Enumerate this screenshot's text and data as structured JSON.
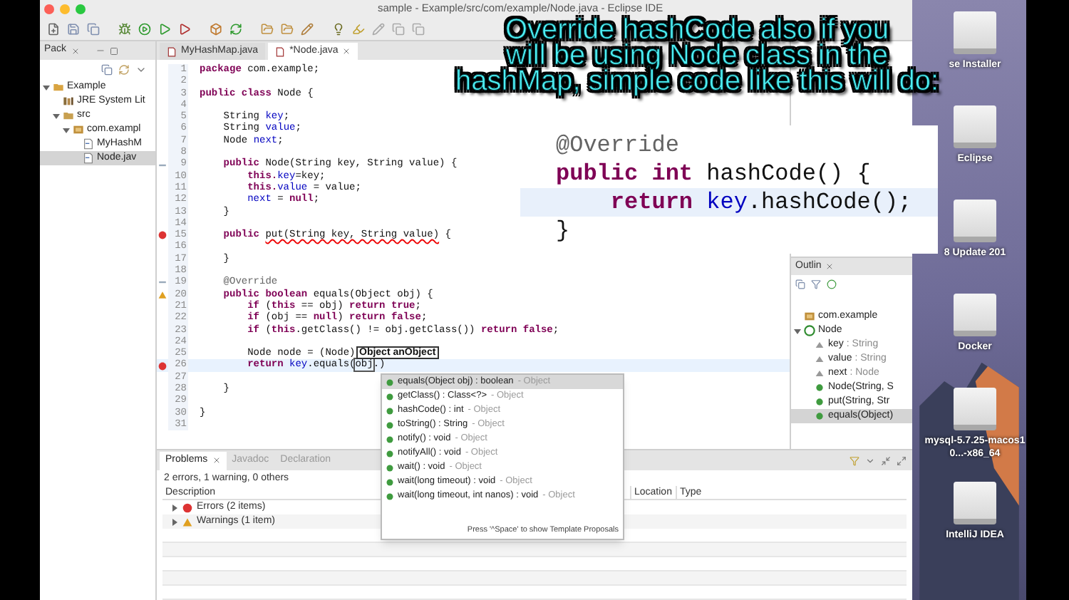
{
  "window": {
    "title": "sample - Example/src/com/example/Node.java - Eclipse IDE"
  },
  "package_explorer": {
    "tab": "Pack",
    "tree": [
      {
        "label": "Example",
        "kind": "project",
        "expanded": true,
        "selected": false,
        "children": [
          {
            "label": "JRE System Lit",
            "kind": "library",
            "selected": false
          },
          {
            "label": "src",
            "kind": "source",
            "expanded": true,
            "selected": false,
            "children": [
              {
                "label": "com.exampl",
                "kind": "package",
                "expanded": true,
                "selected": false,
                "children": [
                  {
                    "label": "MyHashM",
                    "kind": "file",
                    "selected": false
                  },
                  {
                    "label": "Node.jav",
                    "kind": "file",
                    "selected": true
                  }
                ]
              }
            ]
          }
        ]
      }
    ]
  },
  "editor_tabs": [
    {
      "label": "MyHashMap.java",
      "selected": false
    },
    {
      "label": "*Node.java",
      "selected": true
    }
  ],
  "code_lines": [
    {
      "number": "1",
      "kind": "plain",
      "current": false,
      "tokens": [
        {
          "kind": "keyword",
          "text": "package"
        },
        {
          "kind": "plain",
          "text": " com.example;"
        }
      ]
    },
    {
      "number": "2",
      "kind": "plain",
      "current": false
    },
    {
      "number": "3",
      "kind": "plain",
      "current": false,
      "tokens": [
        {
          "kind": "keyword",
          "text": "public class"
        },
        {
          "kind": "plain",
          "text": " Node {"
        }
      ]
    },
    {
      "number": "4",
      "kind": "plain",
      "current": false
    },
    {
      "number": "5",
      "kind": "plain",
      "current": false,
      "tokens": [
        {
          "kind": "plain",
          "text": "    String "
        },
        {
          "kind": "field",
          "text": "key"
        },
        {
          "kind": "plain",
          "text": ";"
        }
      ]
    },
    {
      "number": "6",
      "kind": "plain",
      "current": false,
      "tokens": [
        {
          "kind": "plain",
          "text": "    String "
        },
        {
          "kind": "field",
          "text": "value"
        },
        {
          "kind": "plain",
          "text": ";"
        }
      ]
    },
    {
      "number": "7",
      "kind": "plain",
      "current": false,
      "tokens": [
        {
          "kind": "plain",
          "text": "    Node "
        },
        {
          "kind": "field",
          "text": "next"
        },
        {
          "kind": "plain",
          "text": ";"
        }
      ]
    },
    {
      "number": "8",
      "kind": "plain",
      "current": false
    },
    {
      "number": "9",
      "kind": "fold",
      "current": false,
      "tokens": [
        {
          "kind": "keyword",
          "text": "    public"
        },
        {
          "kind": "plain",
          "text": " Node(String key, String value) {"
        }
      ]
    },
    {
      "number": "10",
      "kind": "plain",
      "current": false,
      "tokens": [
        {
          "kind": "keyword",
          "text": "        this."
        },
        {
          "kind": "field",
          "text": "key"
        },
        {
          "kind": "plain",
          "text": "=key;"
        }
      ]
    },
    {
      "number": "11",
      "kind": "plain",
      "current": false,
      "tokens": [
        {
          "kind": "keyword",
          "text": "        this."
        },
        {
          "kind": "field",
          "text": "value"
        },
        {
          "kind": "plain",
          "text": " = value;"
        }
      ]
    },
    {
      "number": "12",
      "kind": "plain",
      "current": false,
      "tokens": [
        {
          "kind": "field",
          "text": "        next"
        },
        {
          "kind": "plain",
          "text": " = "
        },
        {
          "kind": "keyword",
          "text": "null"
        },
        {
          "kind": "plain",
          "text": ";"
        }
      ]
    },
    {
      "number": "13",
      "kind": "plain",
      "current": false,
      "tokens": [
        {
          "kind": "plain",
          "text": "    }"
        }
      ]
    },
    {
      "number": "14",
      "kind": "plain",
      "current": false
    },
    {
      "number": "15",
      "kind": "error",
      "current": false,
      "tokens": [
        {
          "kind": "keyword",
          "text": "    public "
        },
        {
          "kind": "error",
          "text": "put(String key, String value)"
        },
        {
          "kind": "plain",
          "text": " {"
        }
      ]
    },
    {
      "number": "16",
      "kind": "plain",
      "current": false
    },
    {
      "number": "17",
      "kind": "plain",
      "current": false,
      "tokens": [
        {
          "kind": "plain",
          "text": "    }"
        }
      ]
    },
    {
      "number": "18",
      "kind": "plain",
      "current": false
    },
    {
      "number": "19",
      "kind": "fold",
      "current": false,
      "tokens": [
        {
          "kind": "annotation",
          "text": "    @Override"
        }
      ]
    },
    {
      "number": "20",
      "kind": "warning",
      "current": false,
      "tokens": [
        {
          "kind": "keyword",
          "text": "    public boolean"
        },
        {
          "kind": "plain",
          "text": " equals(Object obj) {"
        }
      ]
    },
    {
      "number": "21",
      "kind": "plain",
      "current": false,
      "tokens": [
        {
          "kind": "keyword",
          "text": "        if"
        },
        {
          "kind": "plain",
          "text": " ("
        },
        {
          "kind": "keyword",
          "text": "this"
        },
        {
          "kind": "plain",
          "text": " == obj) "
        },
        {
          "kind": "keyword",
          "text": "return true"
        },
        {
          "kind": "plain",
          "text": ";"
        }
      ]
    },
    {
      "number": "22",
      "kind": "plain",
      "current": false,
      "tokens": [
        {
          "kind": "keyword",
          "text": "        if"
        },
        {
          "kind": "plain",
          "text": " (obj == "
        },
        {
          "kind": "keyword",
          "text": "null"
        },
        {
          "kind": "plain",
          "text": ") "
        },
        {
          "kind": "keyword",
          "text": "return false"
        },
        {
          "kind": "plain",
          "text": ";"
        }
      ]
    },
    {
      "number": "23",
      "kind": "plain",
      "current": false,
      "tokens": [
        {
          "kind": "keyword",
          "text": "        if"
        },
        {
          "kind": "plain",
          "text": " ("
        },
        {
          "kind": "keyword",
          "text": "this"
        },
        {
          "kind": "plain",
          "text": ".getClass() != obj.getClass()) "
        },
        {
          "kind": "keyword",
          "text": "return false"
        },
        {
          "kind": "plain",
          "text": ";"
        }
      ]
    },
    {
      "number": "24",
      "kind": "plain",
      "current": false
    },
    {
      "number": "25",
      "kind": "plain",
      "current": false,
      "tokens": [
        {
          "kind": "plain",
          "text": "        Node node = (Node)"
        }
      ]
    },
    {
      "number": "26",
      "kind": "error",
      "current": true,
      "tokens": [
        {
          "kind": "keyword",
          "text": "        return "
        },
        {
          "kind": "field",
          "text": "key"
        },
        {
          "kind": "plain",
          "text": ".equals("
        },
        {
          "kind": "boxed",
          "text": "obj"
        },
        {
          "kind": "plain",
          "text": ".)"
        }
      ]
    },
    {
      "number": "27",
      "kind": "plain",
      "current": false
    },
    {
      "number": "28",
      "kind": "plain",
      "current": false,
      "tokens": [
        {
          "kind": "plain",
          "text": "    }"
        }
      ]
    },
    {
      "number": "29",
      "kind": "plain",
      "current": false
    },
    {
      "number": "30",
      "kind": "plain",
      "current": false,
      "tokens": [
        {
          "kind": "plain",
          "text": "}"
        }
      ]
    },
    {
      "number": "31",
      "kind": "plain",
      "current": false
    }
  ],
  "tooltip": {
    "text": "Object anObject"
  },
  "autocomplete": {
    "items": [
      {
        "signature": "equals(Object obj) : boolean",
        "owner": "- Object",
        "selected": true
      },
      {
        "signature": "getClass() : Class<?>",
        "owner": "- Object",
        "selected": false
      },
      {
        "signature": "hashCode() : int",
        "owner": "- Object",
        "selected": false
      },
      {
        "signature": "toString() : String",
        "owner": "- Object",
        "selected": false
      },
      {
        "signature": "notify() : void",
        "owner": "- Object",
        "selected": false
      },
      {
        "signature": "notifyAll() : void",
        "owner": "- Object",
        "selected": false
      },
      {
        "signature": "wait() : void",
        "owner": "- Object",
        "selected": false
      },
      {
        "signature": "wait(long timeout) : void",
        "owner": "- Object",
        "selected": false
      },
      {
        "signature": "wait(long timeout, int nanos) : void",
        "owner": "- Object",
        "selected": false
      }
    ],
    "footer": "Press '^Space' to show Template Proposals"
  },
  "outline": {
    "tab": "Outlin",
    "tree": [
      {
        "label": "com.example",
        "kind": "package",
        "selected": false
      },
      {
        "label": "Node",
        "kind": "class",
        "expanded": true,
        "selected": false,
        "children": [
          {
            "label": "key",
            "type": ": String",
            "kind": "field",
            "selected": false
          },
          {
            "label": "value",
            "type": ": String",
            "kind": "field",
            "selected": false
          },
          {
            "label": "next",
            "type": ": Node",
            "kind": "field",
            "selected": false
          },
          {
            "label": "Node(String, S",
            "kind": "method",
            "selected": false
          },
          {
            "label": "put(String, Str",
            "kind": "method",
            "selected": false
          },
          {
            "label": "equals(Object)",
            "kind": "method",
            "selected": true
          }
        ]
      }
    ]
  },
  "problems": {
    "tabs": [
      {
        "label": "Problems",
        "selected": true
      },
      {
        "label": "Javadoc",
        "selected": false
      },
      {
        "label": "Declaration",
        "selected": false
      }
    ],
    "summary": "2 errors, 1 warning, 0 others",
    "columns": [
      {
        "label": "Description"
      },
      {
        "label": "Location"
      },
      {
        "label": "Type"
      }
    ],
    "rows": [
      {
        "label": "Errors (2 items)",
        "kind": "error",
        "expanded": false
      },
      {
        "label": "Warnings (1 item)",
        "kind": "warning",
        "expanded": false
      }
    ]
  },
  "desktop": {
    "icons": [
      {
        "label": "se Installer"
      },
      {
        "label": "Eclipse"
      },
      {
        "label": "8 Update 201"
      },
      {
        "label": "Docker"
      },
      {
        "label": "mysql-5.7.25-macos10...-x86_64"
      },
      {
        "label": "IntelliJ IDEA"
      }
    ]
  },
  "caption": {
    "lines": [
      "Override hashCode also if you",
      "will be using Node class in the",
      "hashMap, simple code like this will do:"
    ]
  },
  "code_snippet": {
    "lines": [
      {
        "highlighted": false,
        "tokens": [
          {
            "kind": "annotation",
            "text": "@Override"
          }
        ]
      },
      {
        "highlighted": false,
        "tokens": [
          {
            "kind": "keyword",
            "text": "public int"
          },
          {
            "kind": "plain",
            "text": " hashCode() {"
          }
        ]
      },
      {
        "highlighted": true,
        "tokens": [
          {
            "kind": "keyword",
            "text": "    return "
          },
          {
            "kind": "field",
            "text": "key"
          },
          {
            "kind": "plain",
            "text": ".hashCode();"
          }
        ]
      },
      {
        "highlighted": false,
        "tokens": [
          {
            "kind": "plain",
            "text": "}"
          }
        ]
      }
    ]
  }
}
